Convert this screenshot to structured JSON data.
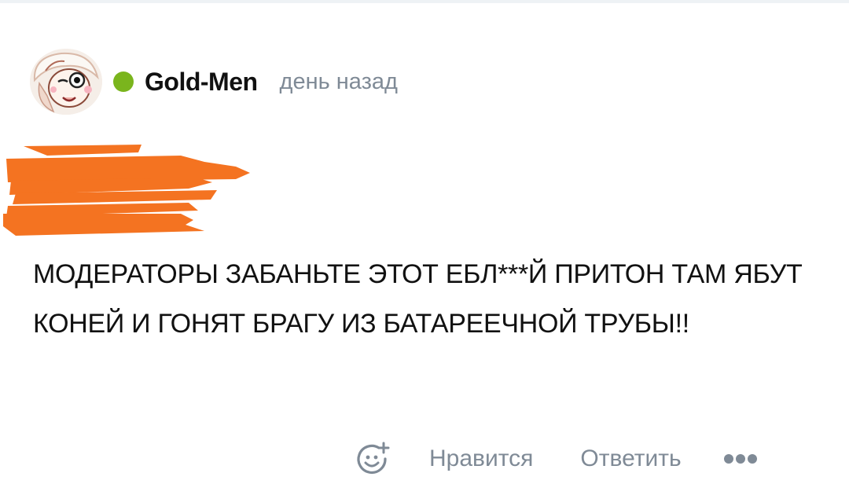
{
  "comment": {
    "author": "Gold-Men",
    "time": "день назад",
    "online_color": "#7ab51d",
    "redaction_color": "#f47321",
    "body": "МОДЕРАТОРЫ ЗАБАНЬТЕ ЭТОТ ЕБЛ***Й ПРИТОН ТАМ ЯБУТ КОНЕЙ И ГОНЯТ БРАГУ ИЗ БАТАРЕЕЧНОЙ ТРУБЫ!!"
  },
  "actions": {
    "react_icon": "add-emoji-icon",
    "like_label": "Нравится",
    "reply_label": "Ответить",
    "more_icon": "more-dots-icon",
    "text_color": "#7f8a96"
  }
}
